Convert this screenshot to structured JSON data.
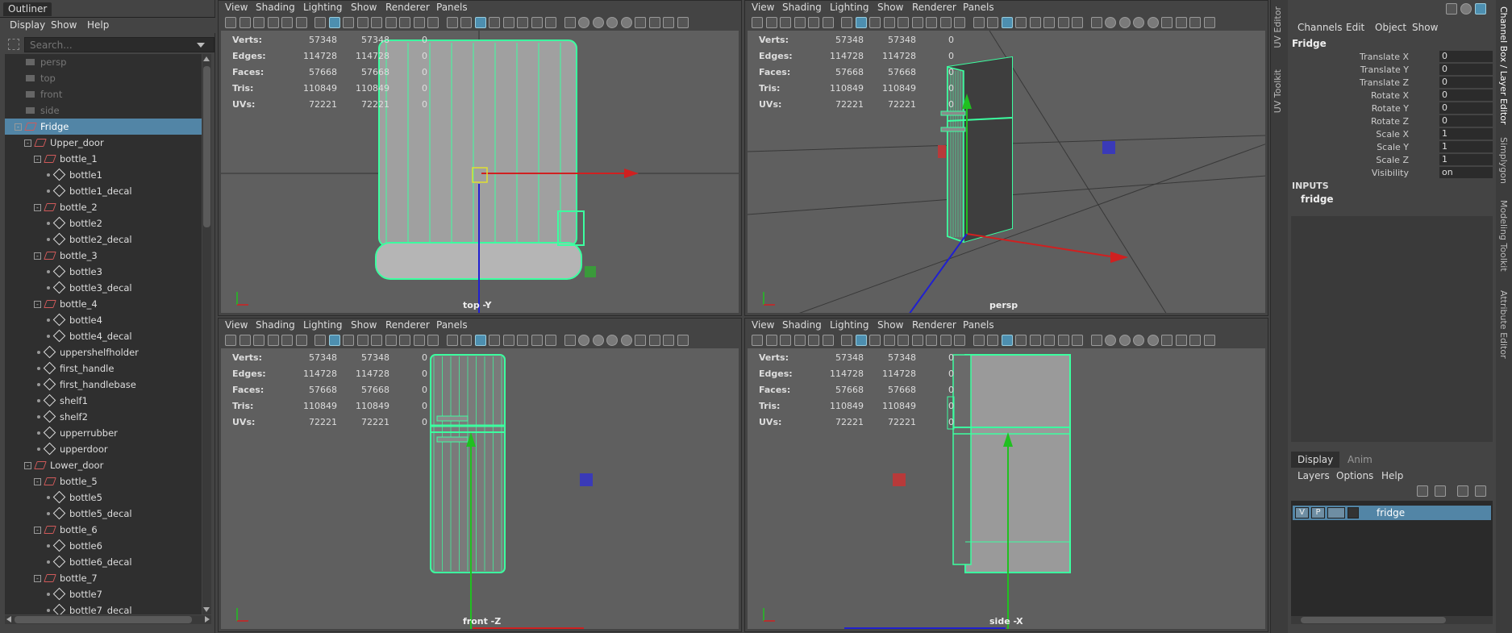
{
  "outliner": {
    "title": "Outliner",
    "menu": [
      "Display",
      "Show",
      "Help"
    ],
    "search_placeholder": "Search...",
    "items": [
      {
        "label": "persp",
        "depth": 0,
        "type": "camera",
        "dim": true
      },
      {
        "label": "top",
        "depth": 0,
        "type": "camera",
        "dim": true
      },
      {
        "label": "front",
        "depth": 0,
        "type": "camera",
        "dim": true
      },
      {
        "label": "side",
        "depth": 0,
        "type": "camera",
        "dim": true
      },
      {
        "label": "Fridge",
        "depth": 0,
        "type": "group",
        "selected": true,
        "expander": "-"
      },
      {
        "label": "Upper_door",
        "depth": 1,
        "type": "group",
        "expander": "-"
      },
      {
        "label": "bottle_1",
        "depth": 2,
        "type": "group",
        "expander": "-"
      },
      {
        "label": "bottle1",
        "depth": 3,
        "type": "mesh"
      },
      {
        "label": "bottle1_decal",
        "depth": 3,
        "type": "mesh"
      },
      {
        "label": "bottle_2",
        "depth": 2,
        "type": "group",
        "expander": "-"
      },
      {
        "label": "bottle2",
        "depth": 3,
        "type": "mesh"
      },
      {
        "label": "bottle2_decal",
        "depth": 3,
        "type": "mesh"
      },
      {
        "label": "bottle_3",
        "depth": 2,
        "type": "group",
        "expander": "-"
      },
      {
        "label": "bottle3",
        "depth": 3,
        "type": "mesh"
      },
      {
        "label": "bottle3_decal",
        "depth": 3,
        "type": "mesh"
      },
      {
        "label": "bottle_4",
        "depth": 2,
        "type": "group",
        "expander": "-"
      },
      {
        "label": "bottle4",
        "depth": 3,
        "type": "mesh"
      },
      {
        "label": "bottle4_decal",
        "depth": 3,
        "type": "mesh"
      },
      {
        "label": "uppershelfholder",
        "depth": 2,
        "type": "mesh"
      },
      {
        "label": "first_handle",
        "depth": 2,
        "type": "mesh"
      },
      {
        "label": "first_handlebase",
        "depth": 2,
        "type": "mesh"
      },
      {
        "label": "shelf1",
        "depth": 2,
        "type": "mesh"
      },
      {
        "label": "shelf2",
        "depth": 2,
        "type": "mesh"
      },
      {
        "label": "upperrubber",
        "depth": 2,
        "type": "mesh"
      },
      {
        "label": "upperdoor",
        "depth": 2,
        "type": "mesh"
      },
      {
        "label": "Lower_door",
        "depth": 1,
        "type": "group",
        "expander": "-"
      },
      {
        "label": "bottle_5",
        "depth": 2,
        "type": "group",
        "expander": "-"
      },
      {
        "label": "bottle5",
        "depth": 3,
        "type": "mesh"
      },
      {
        "label": "bottle5_decal",
        "depth": 3,
        "type": "mesh"
      },
      {
        "label": "bottle_6",
        "depth": 2,
        "type": "group",
        "expander": "-"
      },
      {
        "label": "bottle6",
        "depth": 3,
        "type": "mesh"
      },
      {
        "label": "bottle6_decal",
        "depth": 3,
        "type": "mesh"
      },
      {
        "label": "bottle_7",
        "depth": 2,
        "type": "group",
        "expander": "-"
      },
      {
        "label": "bottle7",
        "depth": 3,
        "type": "mesh"
      },
      {
        "label": "bottle7_decal",
        "depth": 3,
        "type": "mesh"
      }
    ]
  },
  "viewport_menu": [
    "View",
    "Shading",
    "Lighting",
    "Show",
    "Renderer",
    "Panels"
  ],
  "stats": {
    "labels": [
      "Verts:",
      "Edges:",
      "Faces:",
      "Tris:",
      "UVs:"
    ],
    "col1": [
      "57348",
      "114728",
      "57668",
      "110849",
      "72221"
    ],
    "col2": [
      "57348",
      "114728",
      "57668",
      "110849",
      "72221"
    ],
    "col3": [
      "0",
      "0",
      "0",
      "0",
      "0"
    ]
  },
  "viewports": {
    "top": {
      "camera": "top -Y"
    },
    "persp": {
      "camera": "persp"
    },
    "front": {
      "camera": "front -Z"
    },
    "side": {
      "camera": "side -X"
    }
  },
  "side_tabs_left": [
    "UV Editor",
    "UV Toolkit"
  ],
  "side_tabs_right": [
    "Channel Box / Layer Editor",
    "Simplygon",
    "Modeling Toolkit",
    "Attribute Editor"
  ],
  "channel_box": {
    "menu": [
      "Channels",
      "Edit",
      "Object",
      "Show"
    ],
    "object": "Fridge",
    "attributes": [
      {
        "name": "Translate X",
        "value": "0"
      },
      {
        "name": "Translate Y",
        "value": "0"
      },
      {
        "name": "Translate Z",
        "value": "0"
      },
      {
        "name": "Rotate X",
        "value": "0"
      },
      {
        "name": "Rotate Y",
        "value": "0"
      },
      {
        "name": "Rotate Z",
        "value": "0"
      },
      {
        "name": "Scale X",
        "value": "1"
      },
      {
        "name": "Scale Y",
        "value": "1"
      },
      {
        "name": "Scale Z",
        "value": "1"
      },
      {
        "name": "Visibility",
        "value": "on"
      }
    ],
    "inputs_label": "INPUTS",
    "input_node": "fridge"
  },
  "layer_editor": {
    "tabs": [
      "Display",
      "Anim"
    ],
    "menu": [
      "Layers",
      "Options",
      "Help"
    ],
    "layer": {
      "v": "V",
      "p": "P",
      "name": "fridge"
    }
  },
  "colors": {
    "wire": "#3cffa0",
    "selection": "#5285a6",
    "axis_x": "#d02020",
    "axis_y": "#20c020",
    "axis_z": "#2020d0"
  }
}
